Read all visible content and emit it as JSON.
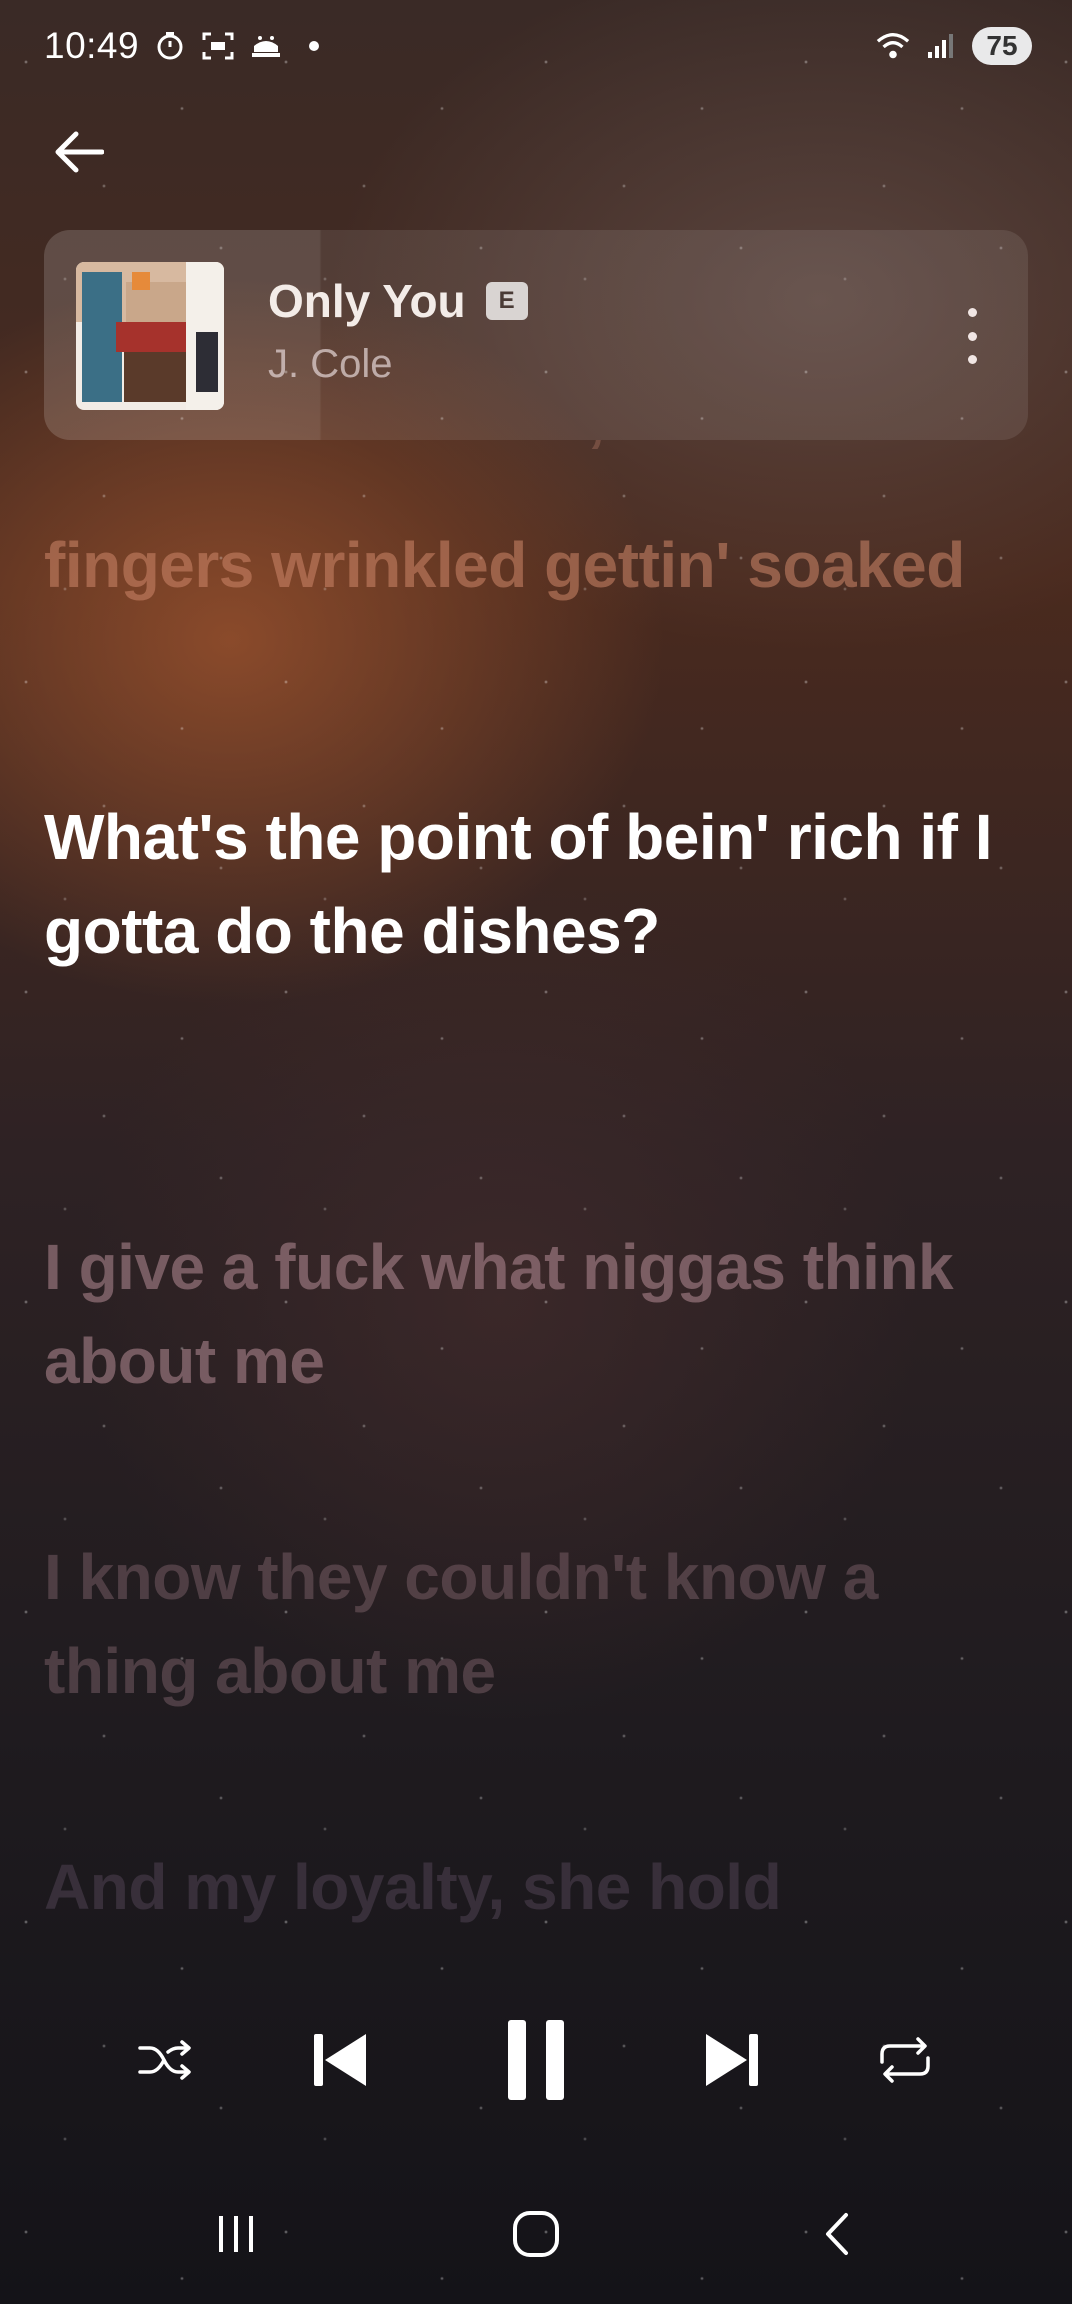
{
  "status_bar": {
    "time": "10:49",
    "battery": "75",
    "icons": [
      "timer-icon",
      "screenshot-icon",
      "notification-icon",
      "dot-icon",
      "wifi-icon",
      "signal-icon"
    ]
  },
  "track": {
    "title": "Only You",
    "explicit": "E",
    "artist": "J. Cole"
  },
  "lyrics": {
    "cut_line": "Dishwasher broke,",
    "previous": "fingers wrinkled gettin' soaked",
    "current": "What's the point of bein' rich if I gotta do the dishes?",
    "next": [
      "I give a fuck what niggas think about me",
      "I know they couldn't know a thing about me",
      "And my loyalty, she hold"
    ]
  },
  "controls": [
    "shuffle-icon",
    "previous-icon",
    "pause-icon",
    "next-icon",
    "repeat-icon"
  ],
  "nav": [
    "recent-apps-icon",
    "home-icon",
    "back-nav-icon"
  ],
  "colors": {
    "current_lyric": "#ffffff",
    "background_warm": "#4a2a1e",
    "background_dark": "#141318"
  }
}
